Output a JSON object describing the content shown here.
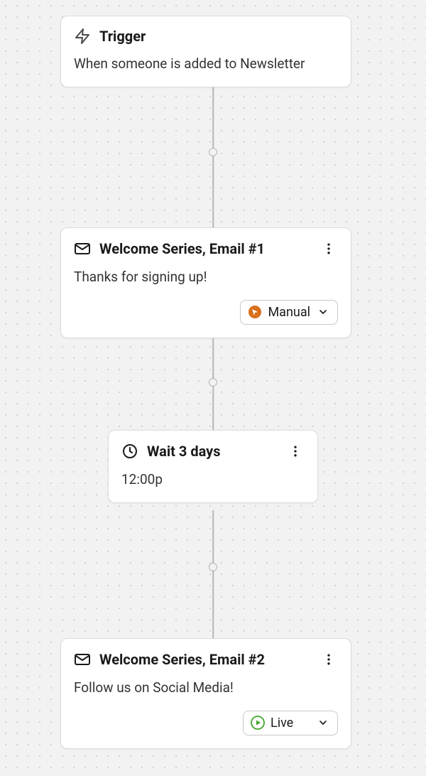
{
  "nodes": {
    "trigger": {
      "title": "Trigger",
      "description": "When someone is added to Newsletter"
    },
    "email1": {
      "title": "Welcome Series, Email #1",
      "subject": "Thanks for signing up!",
      "status_label": "Manual"
    },
    "wait": {
      "title": "Wait 3 days",
      "time": "12:00p"
    },
    "email2": {
      "title": "Welcome Series, Email #2",
      "subject": "Follow us on Social Media!",
      "status_label": "Live"
    }
  },
  "colors": {
    "manual": "#d9701a",
    "live": "#3fa62d"
  }
}
